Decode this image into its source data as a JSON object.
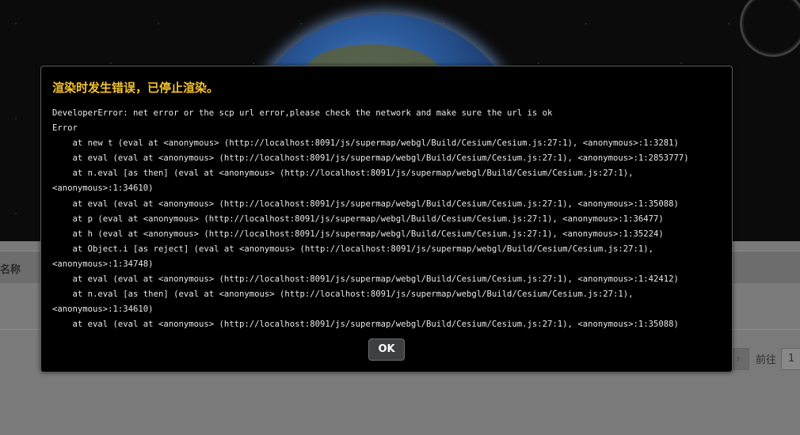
{
  "background": {
    "table": {
      "column_header": "名称"
    },
    "pagination": {
      "next_icon": "chevron-right-icon",
      "goto_label": "前往",
      "page_value": "1"
    }
  },
  "dialog": {
    "title": "渲染时发生错误，已停止渲染。",
    "message": "DeveloperError: net error or the scp url error,please check the network and make sure the url is ok\nError\n    at new t (eval at <anonymous> (http://localhost:8091/js/supermap/webgl/Build/Cesium/Cesium.js:27:1), <anonymous>:1:3281)\n    at eval (eval at <anonymous> (http://localhost:8091/js/supermap/webgl/Build/Cesium/Cesium.js:27:1), <anonymous>:1:2853777)\n    at n.eval [as then] (eval at <anonymous> (http://localhost:8091/js/supermap/webgl/Build/Cesium/Cesium.js:27:1),\n<anonymous>:1:34610)\n    at eval (eval at <anonymous> (http://localhost:8091/js/supermap/webgl/Build/Cesium/Cesium.js:27:1), <anonymous>:1:35088)\n    at p (eval at <anonymous> (http://localhost:8091/js/supermap/webgl/Build/Cesium/Cesium.js:27:1), <anonymous>:1:36477)\n    at h (eval at <anonymous> (http://localhost:8091/js/supermap/webgl/Build/Cesium/Cesium.js:27:1), <anonymous>:1:35224)\n    at Object.i [as reject] (eval at <anonymous> (http://localhost:8091/js/supermap/webgl/Build/Cesium/Cesium.js:27:1),\n<anonymous>:1:34748)\n    at eval (eval at <anonymous> (http://localhost:8091/js/supermap/webgl/Build/Cesium/Cesium.js:27:1), <anonymous>:1:42412)\n    at n.eval [as then] (eval at <anonymous> (http://localhost:8091/js/supermap/webgl/Build/Cesium/Cesium.js:27:1),\n<anonymous>:1:34610)\n    at eval (eval at <anonymous> (http://localhost:8091/js/supermap/webgl/Build/Cesium/Cesium.js:27:1), <anonymous>:1:35088)",
    "ok_label": "OK"
  },
  "colors": {
    "title": "#f5c32a",
    "dialog_bg": "#000000",
    "button_bg": "#3e3f41",
    "overlay": "#7a7a7a"
  }
}
